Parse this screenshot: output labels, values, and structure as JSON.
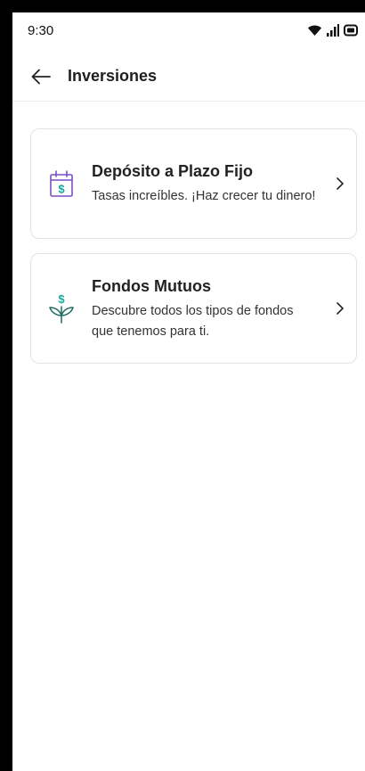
{
  "status": {
    "time": "9:30"
  },
  "header": {
    "title": "Inversiones"
  },
  "cards": [
    {
      "title": "Depósito a Plazo Fijo",
      "description": "Tasas increíbles. ¡Haz crecer tu dinero!",
      "icon": "calendar-dollar-icon",
      "accent": "#7a4fc4"
    },
    {
      "title": "Fondos Mutuos",
      "description": "Descubre todos los tipos de fondos que tenemos para ti.",
      "icon": "money-plant-icon",
      "accent": "#1aa89a"
    }
  ]
}
